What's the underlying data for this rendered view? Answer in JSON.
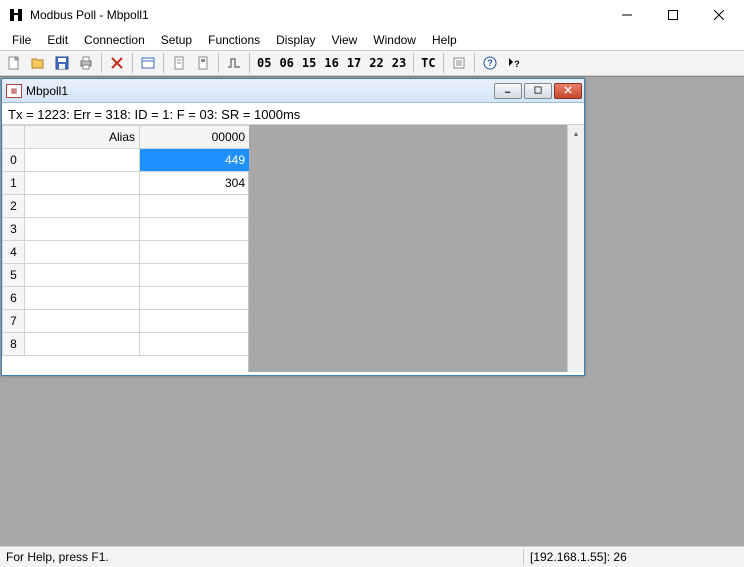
{
  "window": {
    "title": "Modbus Poll - Mbpoll1"
  },
  "menu": {
    "file": "File",
    "edit": "Edit",
    "connection": "Connection",
    "setup": "Setup",
    "functions": "Functions",
    "display": "Display",
    "view": "View",
    "window": "Window",
    "help": "Help"
  },
  "toolbar": {
    "codes": [
      "05",
      "06",
      "15",
      "16",
      "17",
      "22",
      "23"
    ],
    "tc_label": "TC"
  },
  "child": {
    "title": "Mbpoll1",
    "status_line": "Tx = 1223: Err = 318: ID = 1: F = 03: SR = 1000ms",
    "headers": {
      "alias": "Alias",
      "value": "00000"
    },
    "rows": [
      {
        "index": "0",
        "alias": "",
        "value": "449",
        "selected": true
      },
      {
        "index": "1",
        "alias": "",
        "value": "304",
        "selected": false
      },
      {
        "index": "2",
        "alias": "",
        "value": "",
        "selected": false
      },
      {
        "index": "3",
        "alias": "",
        "value": "",
        "selected": false
      },
      {
        "index": "4",
        "alias": "",
        "value": "",
        "selected": false
      },
      {
        "index": "5",
        "alias": "",
        "value": "",
        "selected": false
      },
      {
        "index": "6",
        "alias": "",
        "value": "",
        "selected": false
      },
      {
        "index": "7",
        "alias": "",
        "value": "",
        "selected": false
      },
      {
        "index": "8",
        "alias": "",
        "value": "",
        "selected": false
      }
    ]
  },
  "statusbar": {
    "help": "For Help, press F1.",
    "conn": "[192.168.1.55]: 26"
  }
}
